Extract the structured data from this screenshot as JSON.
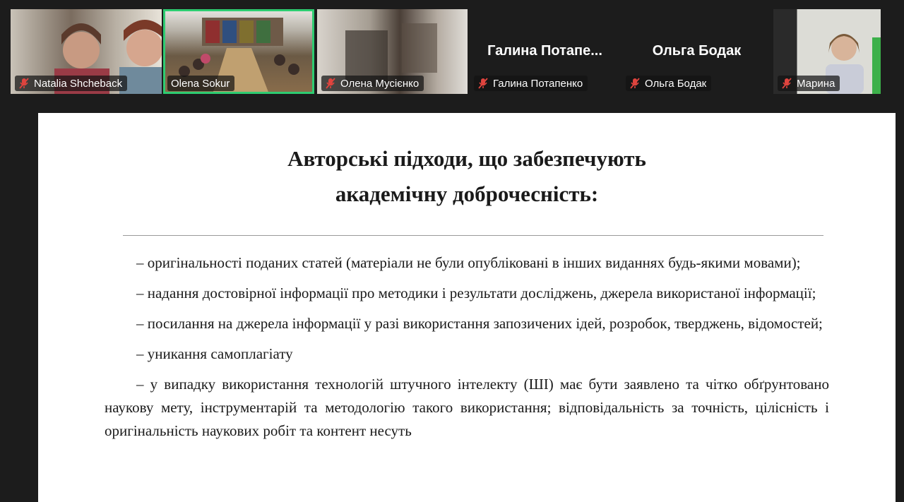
{
  "participants": [
    {
      "name": "Natalia Shcheback",
      "muted": true,
      "video": true
    },
    {
      "name": "Olena Sokur",
      "muted": false,
      "video": true,
      "active_speaker": true
    },
    {
      "name": "Олена Мусієнко",
      "muted": true,
      "video": true
    },
    {
      "name": "Галина Потапенко",
      "display_name": "Галина Потапе...",
      "muted": true,
      "video": false
    },
    {
      "name": "Ольга Бодак",
      "display_name": "Ольга Бодак",
      "muted": true,
      "video": false
    },
    {
      "name": "Марина",
      "muted": true,
      "video": true
    }
  ],
  "slide": {
    "title_line1": "Авторські підходи, що забезпечують",
    "title_line2": "академічну доброчесність:",
    "items": [
      "– оригінальності поданих статей (матеріали не були опубліковані в інших виданнях будь-якими мовами);",
      "– надання достовірної інформації про методики і результати досліджень, джерела використаної інформації;",
      "– посилання на джерела інформації у разі використання запозичених ідей, розробок, тверджень, відомостей;",
      "– уникання самоплагіату",
      "– у випадку використання технологій штучного інтелекту (ШІ) має бути заявлено та чітко обґрунтовано наукову мету, інструментарій та методологію такого використання; відповідальність за точність, цілісність і оригінальність наукових робіт та контент несуть"
    ]
  },
  "colors": {
    "background": "#1c1c1c",
    "active_speaker_border": "#2ecc71",
    "mic_muted": "#e0443e"
  }
}
